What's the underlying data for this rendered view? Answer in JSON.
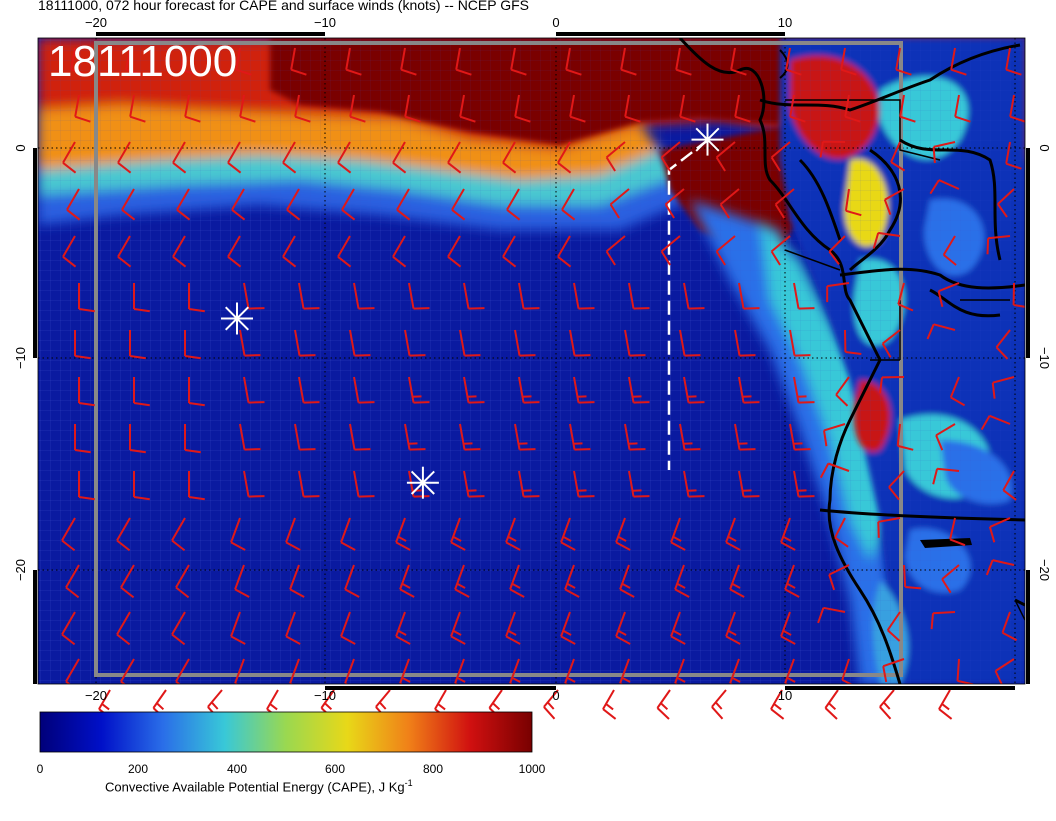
{
  "title": "18111000, 072 hour forecast for CAPE and surface winds (knots) -- NCEP GFS",
  "timestamp_label": "18111000",
  "axes": {
    "x_ticks": [
      "−20",
      "−10",
      "0",
      "10"
    ],
    "y_ticks": [
      "0",
      "−10",
      "−20"
    ]
  },
  "colorbar": {
    "ticks": [
      "0",
      "200",
      "400",
      "600",
      "800",
      "1000"
    ],
    "label": "Convective Available Potential Energy (CAPE), J Kg",
    "label_superscript": "-1",
    "stops": [
      "#00007a",
      "#0010c8",
      "#2a6ee8",
      "#38c8d8",
      "#9ad850",
      "#e8d818",
      "#f08018",
      "#d01010",
      "#780000"
    ]
  },
  "markers": [
    {
      "name": "asterisk",
      "lon": 6.6,
      "lat": 0.4
    },
    {
      "name": "asterisk",
      "lon": -13.9,
      "lat": -8.1
    },
    {
      "name": "asterisk",
      "lon": -5.8,
      "lat": -15.9
    }
  ],
  "colors": {
    "ocean": "#0a1aa0",
    "high_cape": "#7a0000",
    "barb": "#e01818",
    "coast": "#000000",
    "marker": "#ffffff"
  }
}
